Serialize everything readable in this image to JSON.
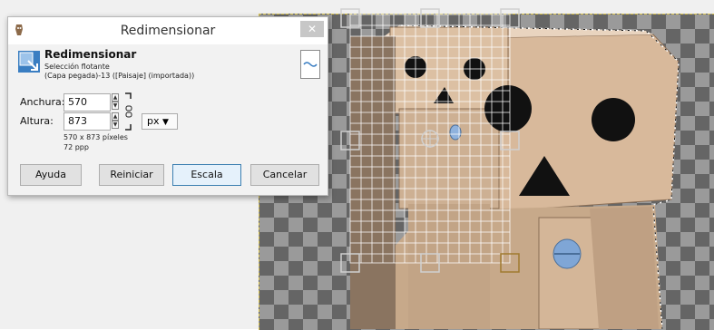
{
  "dialog": {
    "title": "Redimensionar",
    "close_glyph": "✕",
    "header": {
      "name": "Redimensionar",
      "subtitle": "Selección flotante",
      "detail": "(Capa pegada)-13 ([Paisaje] (importada))"
    },
    "width_label": "Anchura:",
    "width_value": "570",
    "height_label": "Altura:",
    "height_value": "873",
    "unit": "px",
    "size_info": "570 x 873 píxeles",
    "resolution": "72 ppp",
    "buttons": {
      "help": "Ayuda",
      "reset": "Reiniciar",
      "scale": "Escala",
      "cancel": "Cancelar"
    }
  },
  "colors": {
    "cardboard": "#d8b99b",
    "accent_blue": "#3c7fb1",
    "selection_yellow": "#d8c24a"
  },
  "icons": [
    "app-icon",
    "scale-tool-icon",
    "chain-icon",
    "close-icon",
    "dropdown-arrow-icon",
    "spin-up-icon",
    "spin-down-icon",
    "preview-icon"
  ]
}
